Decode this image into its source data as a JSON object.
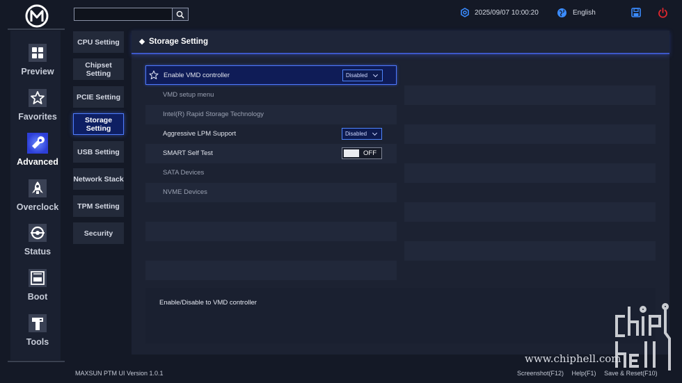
{
  "topbar": {
    "datetime": "2025/09/07 10:00:20",
    "language": "English",
    "search_placeholder": ""
  },
  "nav": {
    "items": [
      {
        "label": "Preview",
        "icon": "grid-icon"
      },
      {
        "label": "Favorites",
        "icon": "star-icon"
      },
      {
        "label": "Advanced",
        "icon": "wrench-icon",
        "active": true
      },
      {
        "label": "Overclock",
        "icon": "rocket-icon"
      },
      {
        "label": "Status",
        "icon": "eye-gear-icon"
      },
      {
        "label": "Boot",
        "icon": "ssd-icon"
      },
      {
        "label": "Tools",
        "icon": "tools-icon"
      }
    ]
  },
  "submenu": {
    "items": [
      {
        "label": "CPU Setting"
      },
      {
        "label": "Chipset Setting"
      },
      {
        "label": "PCIE Setting"
      },
      {
        "label": "Storage Setting",
        "active": true
      },
      {
        "label": "USB Setting"
      },
      {
        "label": "Network Stack"
      },
      {
        "label": "TPM Setting"
      },
      {
        "label": "Security"
      }
    ]
  },
  "main": {
    "title": "Storage Setting",
    "rows": [
      {
        "label": "Enable VMD controller",
        "control": "dropdown",
        "value": "Disabled",
        "selected": true
      },
      {
        "label": "VMD setup menu",
        "dim": true
      },
      {
        "label": "Intel(R) Rapid Storage Technology",
        "dim": true
      },
      {
        "label": "Aggressive LPM Support",
        "control": "dropdown",
        "value": "Disabled"
      },
      {
        "label": "SMART Self Test",
        "control": "toggle",
        "value": "OFF"
      },
      {
        "label": "SATA Devices",
        "dim": true
      },
      {
        "label": "NVME Devices",
        "dim": true
      }
    ],
    "help_text": "Enable/Disable to VMD controller"
  },
  "footer": {
    "version": "MAXSUN PTM UI Version 1.0.1",
    "screenshot": "Screenshot(F12)",
    "help": "Help(F1)",
    "save_reset": "Save & Reset(F10)"
  },
  "watermark": {
    "text": "www.chiphell.com"
  },
  "colors": {
    "accent": "#4f7dff",
    "background": "#141926",
    "panel": "#1c2232",
    "selected": "#0f1c57",
    "power": "#e0262d",
    "icon_blue": "#3b8cff"
  }
}
